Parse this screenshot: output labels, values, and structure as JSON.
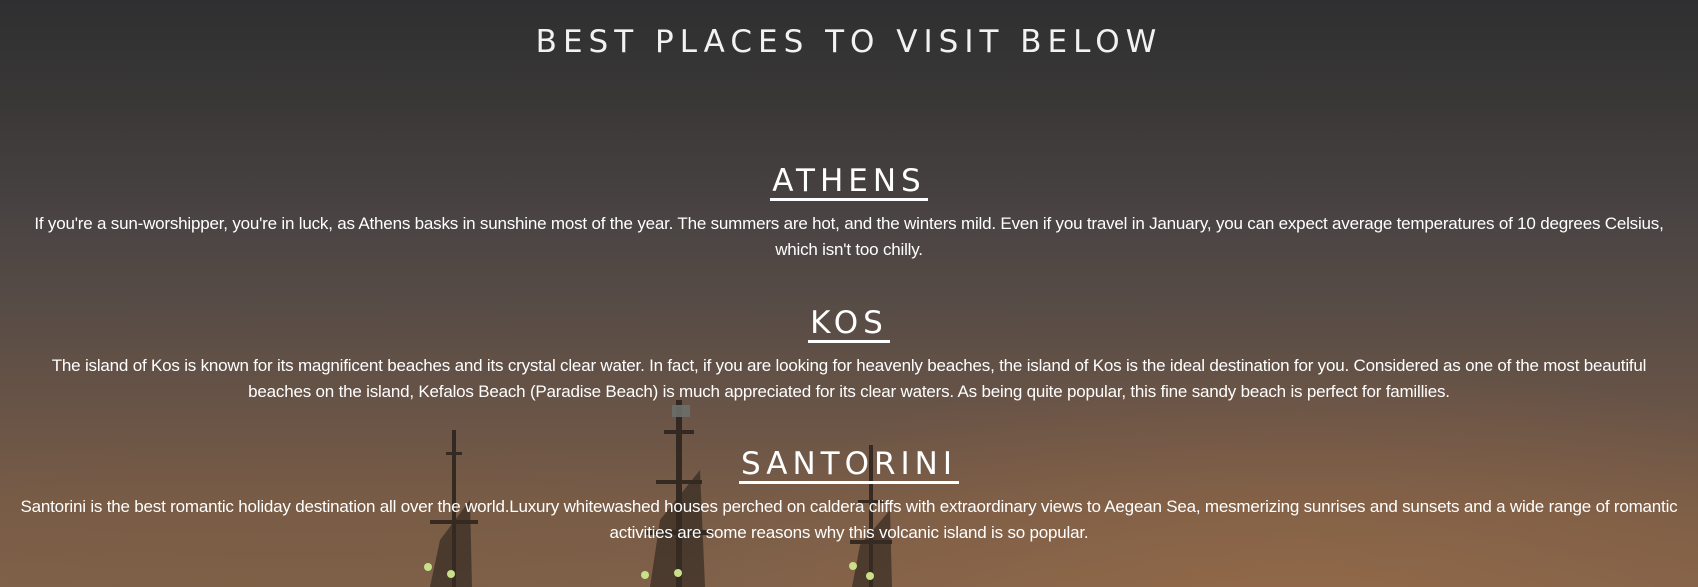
{
  "page": {
    "title": "BEST PLACES TO VISIT BELOW"
  },
  "places": [
    {
      "name": "ATHENS",
      "description": "If you're a sun-worshipper, you're in luck, as Athens basks in sunshine most of the year. The summers are hot, and the winters mild. Even if you travel in January, you can expect average temperatures of 10 degrees Celsius, which isn't too chilly."
    },
    {
      "name": "KOS",
      "description": "The island of Kos is known for its magnificent beaches and its crystal clear water. In fact, if you are looking for heavenly beaches, the island of Kos is the ideal destination for you. Considered as one of the most beautiful beaches on the island, Kefalos Beach (Paradise Beach) is much appreciated for its clear waters. As being quite popular, this fine sandy beach is perfect for famillies."
    },
    {
      "name": "SANTORINI",
      "description": "Santorini is the best romantic holiday destination all over the world.Luxury whitewashed houses perched on caldera cliffs with extraordinary views to Aegean Sea, mesmerizing sunrises and sunsets and a wide range of romantic activities are some reasons why this volcanic island is so popular."
    }
  ],
  "colors": {
    "text": "#ffffff",
    "background_top": "#2f2f31",
    "background_bottom": "#80614a"
  }
}
